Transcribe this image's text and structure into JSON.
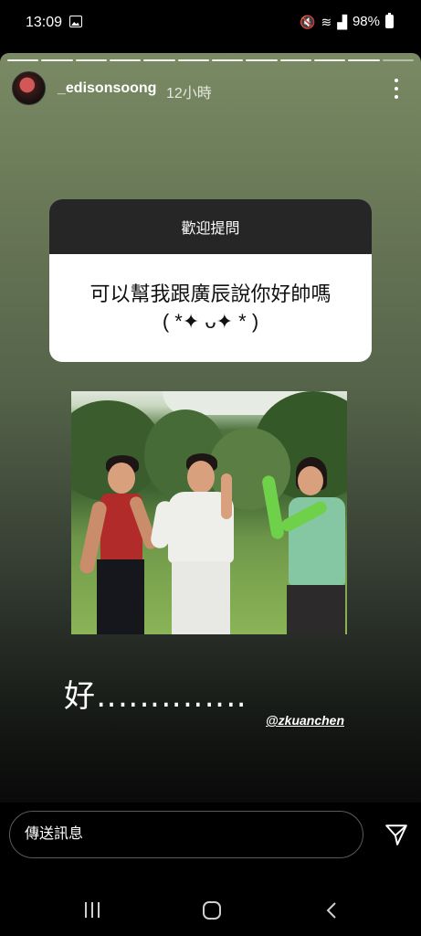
{
  "status_bar": {
    "time": "13:09",
    "battery": "98%",
    "icons": [
      "gallery-icon",
      "mute-icon",
      "wifi-icon",
      "signal-icon",
      "battery-icon"
    ]
  },
  "story": {
    "username": "_edisonsoong",
    "timestamp": "12小時",
    "progress_segments": 12,
    "question_card": {
      "header": "歡迎提問",
      "question_line1": "可以幫我跟廣辰說你好帥嗎",
      "question_line2": "( *✦ ᴗ✦ * )"
    },
    "caption": "好‥‥‥‥‥‥‥",
    "mention": "@zkuanchen"
  },
  "reply_bar": {
    "placeholder": "傳送訊息"
  },
  "colors": {
    "background": "#000000",
    "story_top": "#7a8a64",
    "story_bottom": "#090a09",
    "card_header": "#262626",
    "card_body": "#ffffff"
  }
}
